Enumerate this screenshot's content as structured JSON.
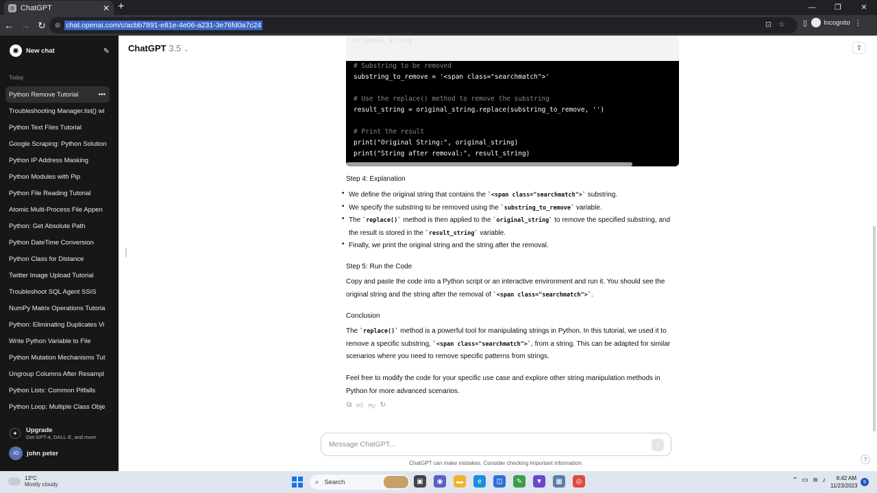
{
  "browser": {
    "tab_title": "ChatGPT",
    "tab_close": "✕",
    "new_tab": "+",
    "url": "chat.openai.com/c/acbb7891-e81e-4e06-a231-3e76fd0a7c24",
    "incognito_label": "Incognito",
    "win_min": "—",
    "win_max": "❐",
    "win_close": "✕"
  },
  "sidebar": {
    "new_chat": "New chat",
    "section": "Today",
    "items": [
      "Python Remove Tutorial",
      "Troubleshooting Manager.list() wi",
      "Python Text Files Tutorial",
      "Google Scraping: Python Solution",
      "Python IP Address Masking",
      "Python Modules with Pip",
      "Python File Reading Tutorial",
      "Atomic Multi-Process File Appen",
      "Python: Get Absolute Path",
      "Python DateTime Conversion",
      "Python Class for Distance",
      "Twitter Image Upload Tutorial",
      "Troubleshoot SQL Agent SSIS",
      "NumPy Matrix Operations Tutoria",
      "Python: Eliminating Duplicates Vi",
      "Write Python Variable to File",
      "Python Mutation Mechanisms Tut",
      "Ungroup Columns After Resampl",
      "Python Lists: Common Pitfalls",
      "Python Loop: Multiple Class Obje"
    ],
    "upgrade_title": "Upgrade",
    "upgrade_sub": "Get GPT-4, DALL·E, and more",
    "user_initials": "JO",
    "user_name": "john peter"
  },
  "header": {
    "model": "ChatGPT",
    "version": "3.5"
  },
  "code": {
    "faded_line": "original_string",
    "lines": [
      "# Substring to be removed",
      "substring_to_remove = '<span class=\"searchmatch\">'",
      "",
      "# Use the replace() method to remove the substring",
      "result_string = original_string.replace(substring_to_remove, '')",
      "",
      "# Print the result",
      "print(\"Original String:\", original_string)",
      "print(\"String after removal:\", result_string)"
    ]
  },
  "content": {
    "step4_title": "Step 4: Explanation",
    "b1_a": "We define the original string that contains the ",
    "b1_code": "`<span class=\"searchmatch\">`",
    "b1_b": " substring.",
    "b2_a": "We specify the substring to be removed using the ",
    "b2_code": "`substring_to_remove`",
    "b2_b": " variable.",
    "b3_a": "The ",
    "b3_code1": "`replace()`",
    "b3_b": " method is then applied to the ",
    "b3_code2": "`original_string`",
    "b3_c": " to remove the specified substring, and the result is stored in the ",
    "b3_code3": "`result_string`",
    "b3_d": " variable.",
    "b4": "Finally, we print the original string and the string after the removal.",
    "step5_title": "Step 5: Run the Code",
    "step5_a": "Copy and paste the code into a Python script or an interactive environment and run it. You should see the original string and the string after the removal of ",
    "step5_code": "`<span class=\"searchmatch\">`",
    "step5_b": ".",
    "conclusion_title": "Conclusion",
    "concl_a": "The ",
    "concl_code1": "`replace()`",
    "concl_b": " method is a powerful tool for manipulating strings in Python. In this tutorial, we used it to remove a specific substring, ",
    "concl_code2": "`<span class=\"searchmatch\">`",
    "concl_c": ", from a string. This can be adapted for similar scenarios where you need to remove specific patterns from strings.",
    "final": "Feel free to modify the code for your specific use case and explore other string manipulation methods in Python for more advanced scenarios."
  },
  "composer": {
    "placeholder": "Message ChatGPT...",
    "disclaimer": "ChatGPT can make mistakes. Consider checking important information.",
    "help": "?"
  },
  "taskbar": {
    "temp": "13°C",
    "weather": "Mostly cloudy",
    "search": "Search",
    "time": "8:42 AM",
    "date": "11/23/2023",
    "notifications": "9"
  }
}
